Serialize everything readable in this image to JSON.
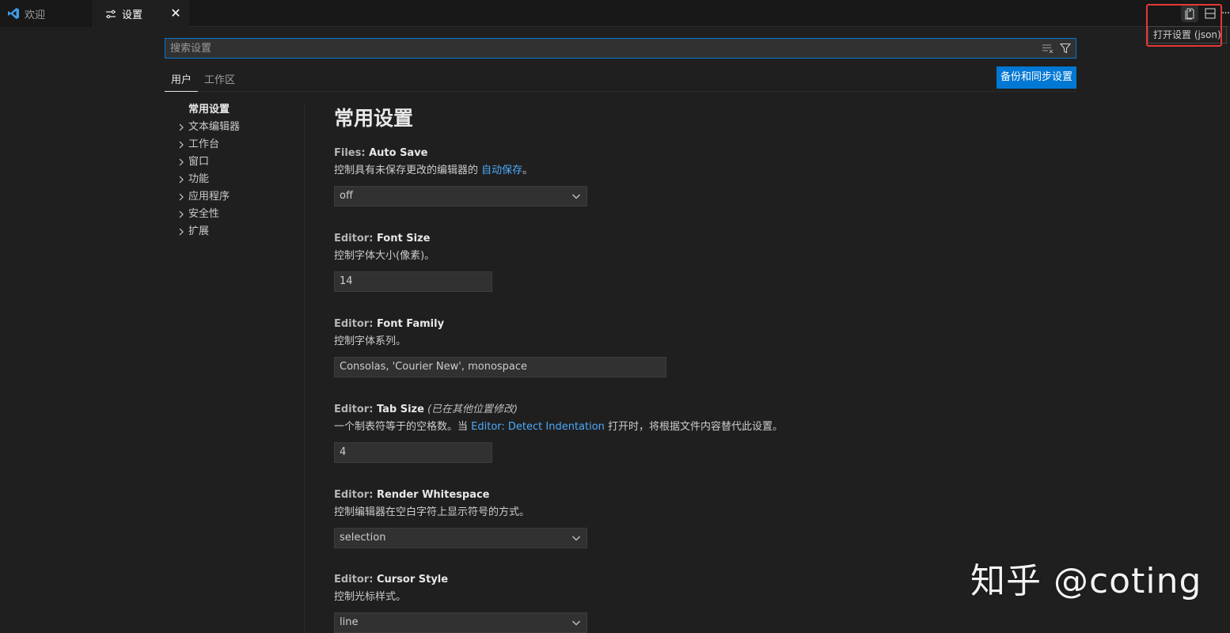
{
  "tabs": [
    {
      "label": "欢迎",
      "icon": "vscode-logo-icon"
    },
    {
      "label": "设置",
      "icon": "settings-editor-icon"
    }
  ],
  "tooltip": "打开设置 (json)",
  "search": {
    "placeholder": "搜索设置"
  },
  "scope_tabs": {
    "user": "用户",
    "workspace": "工作区"
  },
  "sync_button": "备份和同步设置",
  "toc": [
    "常用设置",
    "文本编辑器",
    "工作台",
    "窗口",
    "功能",
    "应用程序",
    "安全性",
    "扩展"
  ],
  "section_title": "常用设置",
  "settings": [
    {
      "category": "Files: ",
      "name": "Auto Save",
      "desc_before": "控制具有未保存更改的编辑器的 ",
      "desc_link": "自动保存",
      "desc_after": "。",
      "value": "off"
    },
    {
      "category": "Editor: ",
      "name": "Font Size",
      "desc": "控制字体大小(像素)。",
      "value": "14"
    },
    {
      "category": "Editor: ",
      "name": "Font Family",
      "desc": "控制字体系列。",
      "value": "Consolas, 'Courier New', monospace"
    },
    {
      "category": "Editor: ",
      "name": "Tab Size",
      "modified": "(已在其他位置修改)",
      "desc_before": "一个制表符等于的空格数。当 ",
      "desc_link": "Editor: Detect Indentation",
      "desc_after": " 打开时，将根据文件内容替代此设置。",
      "value": "4"
    },
    {
      "category": "Editor: ",
      "name": "Render Whitespace",
      "desc": "控制编辑器在空白字符上显示符号的方式。",
      "value": "selection"
    },
    {
      "category": "Editor: ",
      "name": "Cursor Style",
      "desc": "控制光标样式。",
      "value": "line"
    }
  ],
  "watermark": "知乎 @coting",
  "colors": {
    "accent": "#0078d4",
    "link": "#4daafc",
    "highlight": "#e53935",
    "background": "#1f1f1f"
  }
}
